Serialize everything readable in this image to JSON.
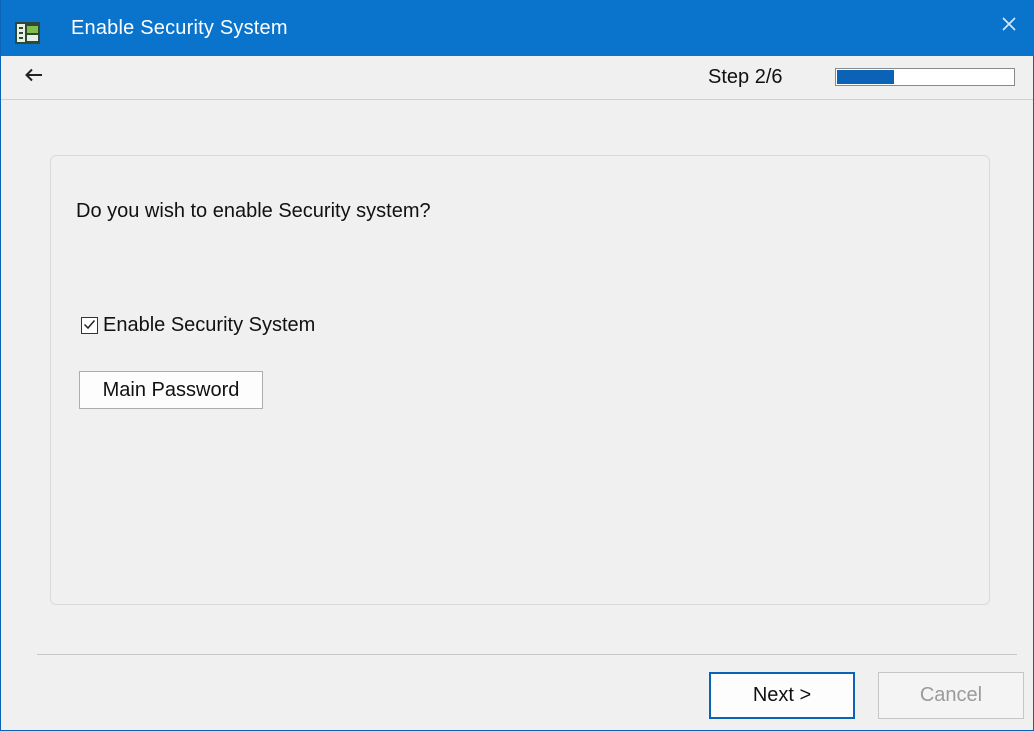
{
  "window": {
    "title": "Enable Security System",
    "close_label": "×"
  },
  "toolbar": {
    "step_text": "Step 2/6",
    "progress_fraction": 0.33,
    "accent_color": "#0b63b8"
  },
  "panel": {
    "question": "Do you wish to enable Security system?",
    "checkbox_label": "Enable Security System",
    "checkbox_checked": true,
    "main_password_label": "Main Password"
  },
  "footer": {
    "next_label": "Next >",
    "cancel_label": "Cancel"
  },
  "icons": {
    "app": "app-icon",
    "back": "back-arrow-icon",
    "close": "close-icon",
    "check": "checkmark-icon"
  }
}
